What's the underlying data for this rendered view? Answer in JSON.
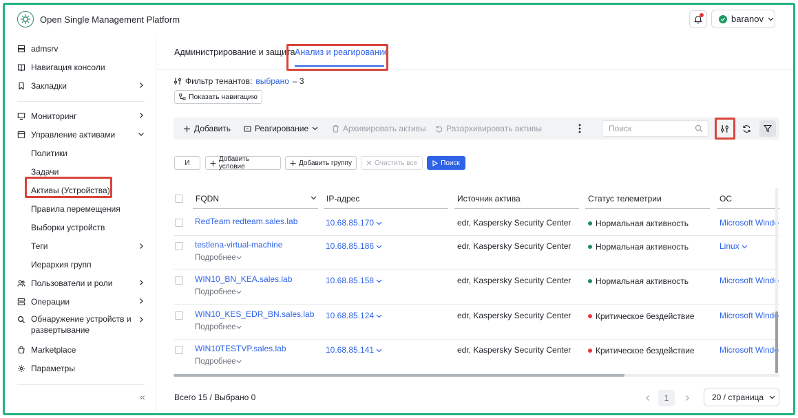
{
  "app": {
    "title": "Open Single Management Platform",
    "user": "baranov"
  },
  "sidebar": {
    "top": [
      {
        "label": "admsrv",
        "icon": "server-icon"
      },
      {
        "label": "Навигация консоли",
        "icon": "book-icon"
      },
      {
        "label": "Закладки",
        "icon": "bookmark-icon"
      }
    ],
    "items": [
      {
        "label": "Мониторинг",
        "icon": "monitor-icon"
      },
      {
        "label": "Управление активами",
        "icon": "assets-icon"
      }
    ],
    "sub": [
      "Политики",
      "Задачи",
      "Активы (Устройства)",
      "Правила перемещения",
      "Выборки устройств",
      "Теги",
      "Иерархия групп"
    ],
    "bottom": [
      {
        "label": "Пользователи и роли",
        "icon": "users-icon"
      },
      {
        "label": "Операции",
        "icon": "operations-icon"
      },
      {
        "label": "Обнаружение устройств и",
        "label2": "развертывание",
        "icon": "discovery-icon"
      },
      {
        "label": "Marketplace",
        "icon": "marketplace-icon"
      },
      {
        "label": "Параметры",
        "icon": "gear-icon"
      }
    ],
    "collapse": "«"
  },
  "tabs": [
    "Администрирование и защита",
    "Анализ и реагирование"
  ],
  "tenant": {
    "label": "Фильтр тенантов:",
    "link": "выбрано",
    "count": "– 3",
    "show_nav": "Показать навигацию"
  },
  "toolbar": {
    "add": "Добавить",
    "response": "Реагирование",
    "archive": "Архивировать активы",
    "unarchive": "Разархивировать активы",
    "search_placeholder": "Поиск"
  },
  "filter": {
    "and": "И",
    "add_condition": "Добавить условие",
    "add_group": "Добавить группу",
    "clear": "Очистить все",
    "search": "Поиск"
  },
  "table": {
    "columns": [
      "FQDN",
      "IP-адрес",
      "Источник актива",
      "Статус телеметрии",
      "ОС"
    ],
    "more_label": "Подробнее",
    "rows": [
      {
        "fqdn": "RedTeam redteam.sales.lab",
        "ip": "10.68.85.170",
        "source": "edr, Kaspersky Security Center",
        "status": "Нормальная активность",
        "status_color": "#1f8a5c",
        "os": "Microsoft Windo",
        "more": false
      },
      {
        "fqdn": "testlena-virtual-machine",
        "ip": "10.68.85.186",
        "source": "edr, Kaspersky Security Center",
        "status": "Нормальная активность",
        "status_color": "#1f8a5c",
        "os": "Linux",
        "more": true
      },
      {
        "fqdn": "WIN10_BN_KEA.sales.lab",
        "ip": "10.68.85.158",
        "source": "edr, Kaspersky Security Center",
        "status": "Нормальная активность",
        "status_color": "#1f8a5c",
        "os": "Microsoft Windo",
        "more": true
      },
      {
        "fqdn": "WIN10_KES_EDR_BN.sales.lab",
        "ip": "10.68.85.124",
        "source": "edr, Kaspersky Security Center",
        "status": "Критическое бездействие",
        "status_color": "#e5363b",
        "os": "Microsoft Windo",
        "more": true
      },
      {
        "fqdn": "WIN10TESTVP.sales.lab",
        "ip": "10.68.85.141",
        "source": "edr, Kaspersky Security Center",
        "status": "Критическое бездействие",
        "status_color": "#e5363b",
        "os": "Microsoft Windo",
        "more": true
      }
    ]
  },
  "footer": {
    "total": "Всего 15 / Выбрано 0",
    "page": "1",
    "page_size": "20 / страница"
  }
}
